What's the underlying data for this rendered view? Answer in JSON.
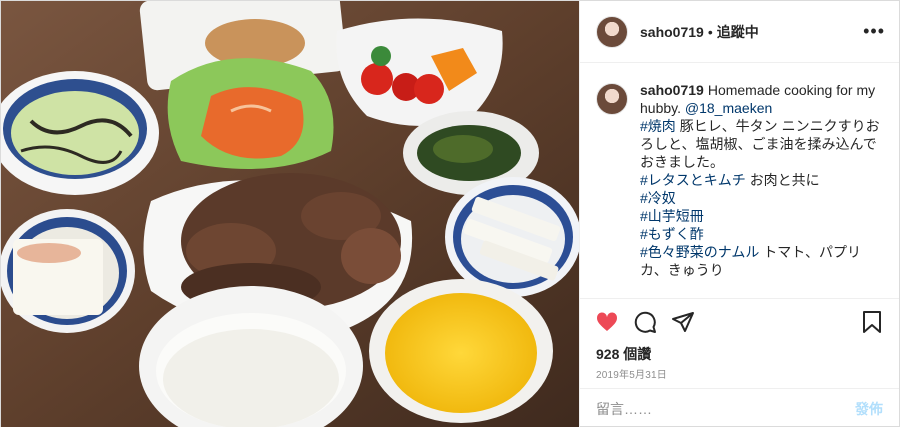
{
  "header": {
    "username": "saho0719",
    "dot": "•",
    "follow_label": "追蹤中",
    "more_icon": "more-icon"
  },
  "caption": {
    "username": "saho0719",
    "text_line1": "Homemade cooking for my hubby.",
    "mention": "@18_maeken",
    "tag1": "#焼肉",
    "text1": "豚ヒレ、牛タン ニンニクすりおろしと、塩胡椒、ごま油を揉み込んでおきました。",
    "tag2": "#レタスとキムチ",
    "text2": "お肉と共に",
    "tag3": "#冷奴",
    "tag4": "#山芋短冊",
    "tag5": "#もずく酢",
    "tag6": "#色々野菜のナムル",
    "text6": "トマト、パプリカ、きゅうり"
  },
  "actions": {
    "like_icon": "heart-icon",
    "like_color": "#ed4956",
    "comment_icon": "comment-icon",
    "share_icon": "share-icon",
    "save_icon": "bookmark-icon"
  },
  "likes": "928 個讚",
  "date": "2019年5月31日",
  "comment": {
    "placeholder": "留言……",
    "post_label": "發佈",
    "post_color": "#b2dffc"
  }
}
